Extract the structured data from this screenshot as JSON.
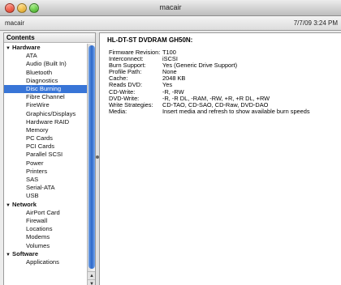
{
  "window": {
    "title": "macair",
    "machine_name": "macair",
    "datetime": "7/7/09 3:24 PM"
  },
  "sidebar": {
    "header": "Contents",
    "rows": [
      {
        "label": "Hardware",
        "kind": "group"
      },
      {
        "label": "ATA",
        "kind": "item"
      },
      {
        "label": "Audio (Built In)",
        "kind": "item"
      },
      {
        "label": "Bluetooth",
        "kind": "item"
      },
      {
        "label": "Diagnostics",
        "kind": "item"
      },
      {
        "label": "Disc Burning",
        "kind": "item",
        "selected": true
      },
      {
        "label": "Fibre Channel",
        "kind": "item"
      },
      {
        "label": "FireWire",
        "kind": "item"
      },
      {
        "label": "Graphics/Displays",
        "kind": "item"
      },
      {
        "label": "Hardware RAID",
        "kind": "item"
      },
      {
        "label": "Memory",
        "kind": "item"
      },
      {
        "label": "PC Cards",
        "kind": "item"
      },
      {
        "label": "PCI Cards",
        "kind": "item"
      },
      {
        "label": "Parallel SCSI",
        "kind": "item"
      },
      {
        "label": "Power",
        "kind": "item"
      },
      {
        "label": "Printers",
        "kind": "item"
      },
      {
        "label": "SAS",
        "kind": "item"
      },
      {
        "label": "Serial-ATA",
        "kind": "item"
      },
      {
        "label": "USB",
        "kind": "item"
      },
      {
        "label": "Network",
        "kind": "group"
      },
      {
        "label": "AirPort Card",
        "kind": "item"
      },
      {
        "label": "Firewall",
        "kind": "item"
      },
      {
        "label": "Locations",
        "kind": "item"
      },
      {
        "label": "Modems",
        "kind": "item"
      },
      {
        "label": "Volumes",
        "kind": "item"
      },
      {
        "label": "Software",
        "kind": "group"
      },
      {
        "label": "Applications",
        "kind": "item"
      }
    ],
    "expand_glyph": "▼",
    "scroll_up_glyph": "▲",
    "scroll_down_glyph": "▼"
  },
  "detail": {
    "title": "HL-DT-ST DVDRAM GH50N:",
    "rows": [
      {
        "label": "Firmware Revision:",
        "value": "T100"
      },
      {
        "label": "Interconnect:",
        "value": "iSCSI"
      },
      {
        "label": "Burn Support:",
        "value": "Yes (Generic Drive Support)"
      },
      {
        "label": "Profile Path:",
        "value": "None"
      },
      {
        "label": "Cache:",
        "value": "2048 KB"
      },
      {
        "label": "Reads DVD:",
        "value": "Yes"
      },
      {
        "label": "CD-Write:",
        "value": "-R, -RW"
      },
      {
        "label": "DVD-Write:",
        "value": "-R, -R DL, -RAM, -RW, +R, +R DL, +RW"
      },
      {
        "label": "Write Strategies:",
        "value": "CD-TAO, CD-SAO, CD-Raw, DVD-DAO"
      },
      {
        "label": "Media:",
        "value": "Insert media and refresh to show available burn speeds"
      }
    ]
  },
  "colors": {
    "selection": "#3875d7",
    "scroll_thumb": "#2c67c8"
  }
}
